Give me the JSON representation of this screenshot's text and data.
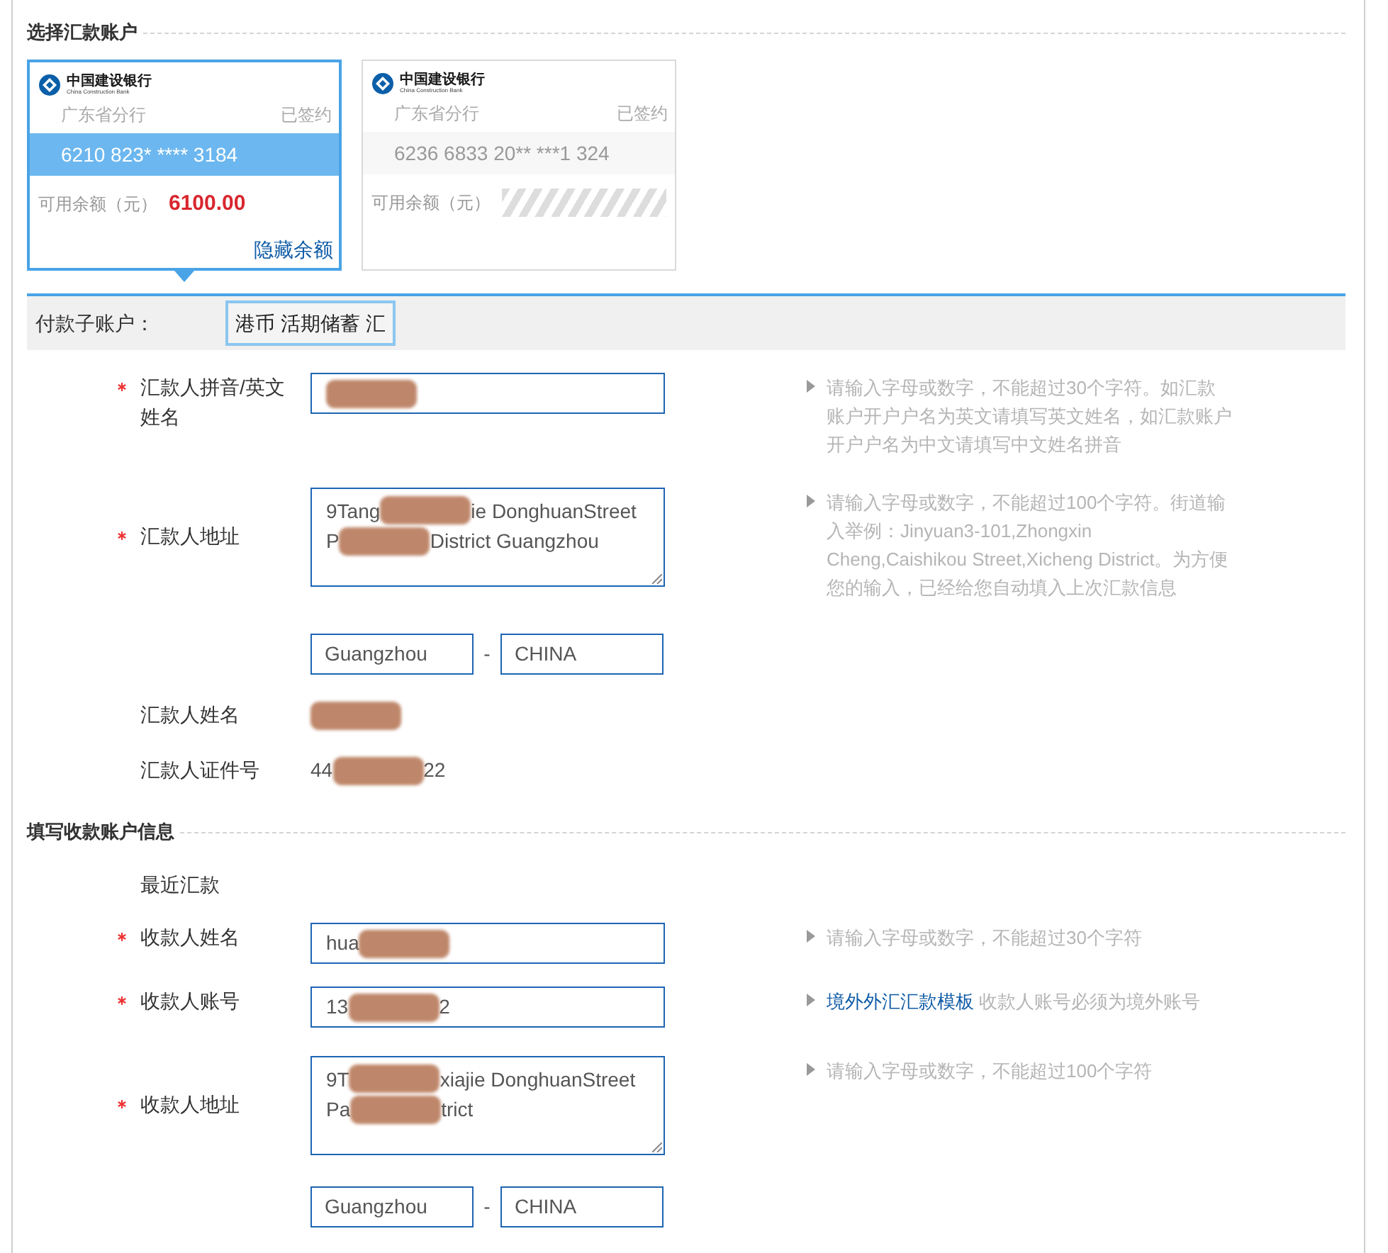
{
  "payer_section": {
    "title": "选择汇款账户",
    "accounts": [
      {
        "logo_text": "中国建设银行",
        "logo_subtext": "China Construction Bank",
        "branch": "广东省分行",
        "status": "已签约",
        "number": "6210 823* **** 3184",
        "balance_label": "可用余额（元）",
        "balance": "6100.00",
        "balance_hidden": false,
        "toggle_link": "隐藏余额",
        "selected": true
      },
      {
        "logo_text": "中国建设银行",
        "logo_subtext": "China Construction Bank",
        "branch": "广东省分行",
        "status": "已签约",
        "number": "6236 6833 20** ***1 324",
        "balance_label": "可用余额（元）",
        "balance_hidden": true,
        "selected": false
      }
    ],
    "sub_account": {
      "label": "付款子账户：",
      "value": "港币 活期储蓄 汇"
    },
    "fields": [
      {
        "kind": "input",
        "required": true,
        "label": "汇款人拼音/英文姓名",
        "value": [
          {
            "kind": "redaction"
          }
        ],
        "hint": [
          {
            "text": "请输入字母或数字，不能超过30个字符。如汇款账户开户户名为英文请填写英文姓名，如汇款账户开户户名为中文请填写中文姓名拼音"
          }
        ]
      },
      {
        "kind": "textarea",
        "required": true,
        "label": "汇款人地址",
        "lines": [
          [
            {
              "text": "9Tang"
            },
            {
              "kind": "redaction"
            },
            {
              "text": "ie DonghuanStreet"
            }
          ],
          [
            {
              "text": "P"
            },
            {
              "kind": "redaction"
            },
            {
              "text": "District Guangzhou"
            }
          ]
        ],
        "hint": [
          {
            "text": "请输入字母或数字，不能超过100个字符。街道输入举例：Jinyuan3-101,Zhongxin Cheng,Caishikou Street,Xicheng District。为方便您的输入，已经给您自动填入上次汇款信息"
          }
        ]
      },
      {
        "kind": "city_country",
        "city": "Guangzhou",
        "separator": "-",
        "country": "CHINA"
      },
      {
        "kind": "static",
        "label": "汇款人姓名",
        "value": [
          {
            "kind": "redaction"
          }
        ]
      },
      {
        "kind": "static",
        "label": "汇款人证件号",
        "value": [
          {
            "text": "44"
          },
          {
            "kind": "redaction"
          },
          {
            "text": "22"
          }
        ]
      }
    ]
  },
  "payee_section": {
    "title": "填写收款账户信息",
    "fields": [
      {
        "kind": "link_label",
        "label": "最近汇款"
      },
      {
        "kind": "input",
        "required": true,
        "label": "收款人姓名",
        "value": [
          {
            "text": "hua"
          },
          {
            "kind": "redaction"
          }
        ],
        "hint": [
          {
            "text": "请输入字母或数字，不能超过30个字符"
          }
        ]
      },
      {
        "kind": "input",
        "required": true,
        "label": "收款人账号",
        "value": [
          {
            "text": "13"
          },
          {
            "kind": "redaction"
          },
          {
            "text": "2"
          }
        ],
        "hint": [
          {
            "kind": "link",
            "text": "境外外汇汇款模板"
          },
          {
            "text": "收款人账号必须为境外账号"
          }
        ]
      },
      {
        "kind": "textarea",
        "required": true,
        "label": "收款人地址",
        "lines": [
          [
            {
              "text": "9T"
            },
            {
              "kind": "redaction"
            },
            {
              "text": "xiajie DonghuanStreet"
            }
          ],
          [
            {
              "text": "Pa"
            },
            {
              "kind": "redaction"
            },
            {
              "text": "trict"
            }
          ]
        ],
        "hint": [
          {
            "text": "请输入字母或数字，不能超过100个字符"
          }
        ]
      },
      {
        "kind": "city_country",
        "city": "Guangzhou",
        "separator": "-",
        "country": "CHINA"
      }
    ]
  }
}
